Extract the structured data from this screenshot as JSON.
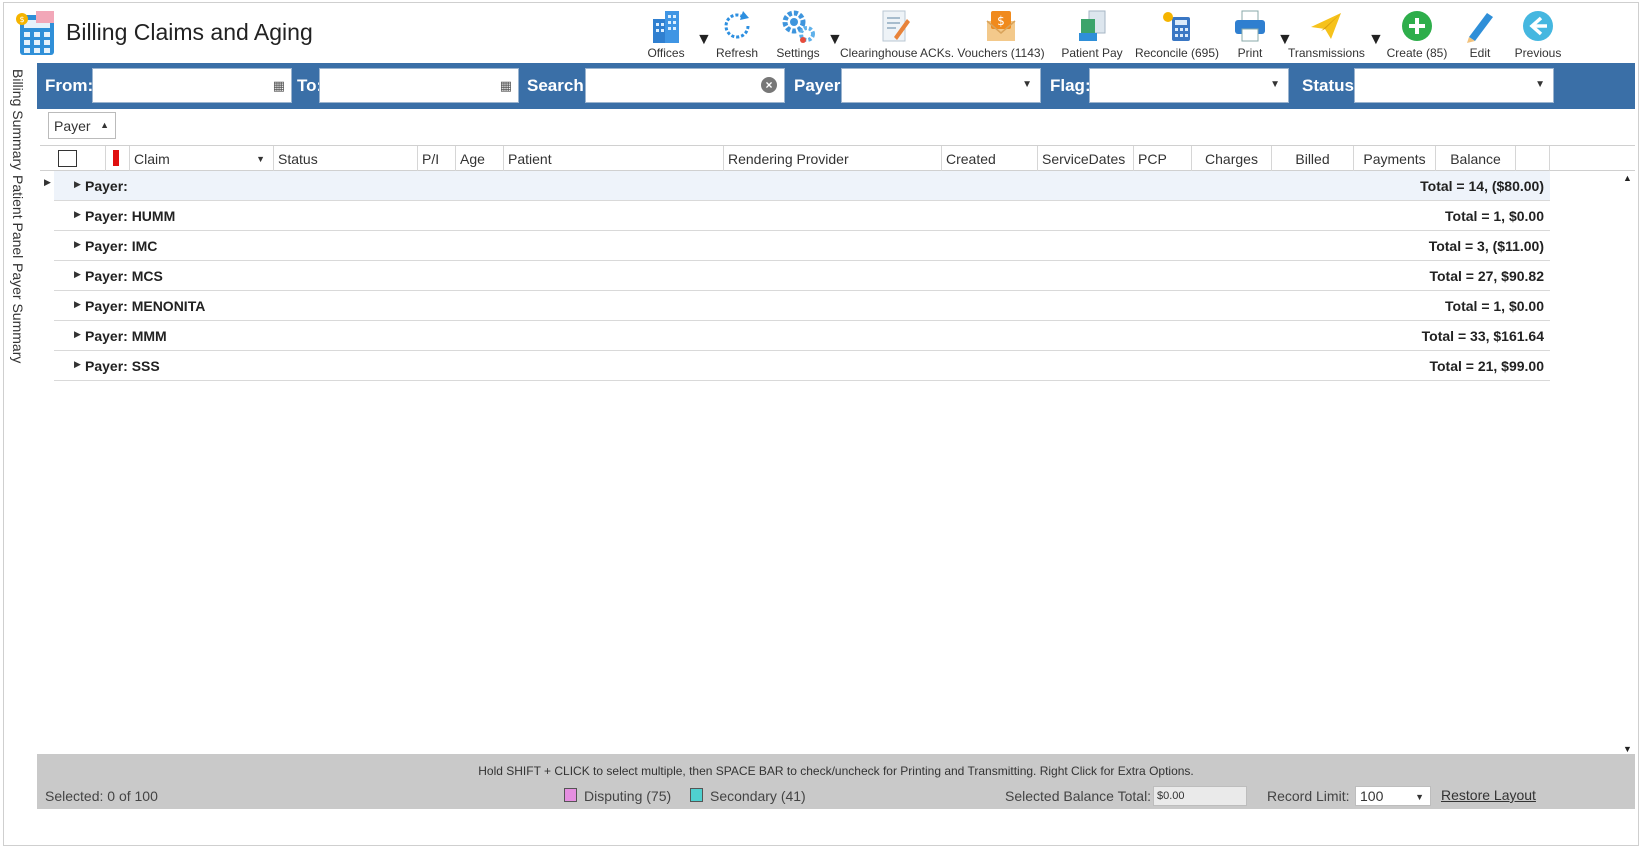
{
  "app": {
    "title": "Billing Claims and Aging",
    "icon": "billing-calculator-icon"
  },
  "toolbar": [
    {
      "label": "Offices",
      "icon": "offices-building-icon",
      "dropdown": true
    },
    {
      "label": "Refresh",
      "icon": "refresh-icon",
      "dropdown": false
    },
    {
      "label": "Settings",
      "icon": "settings-gears-icon",
      "dropdown": true
    },
    {
      "label": "Clearinghouse ACKs.",
      "icon": "clearinghouse-document-icon",
      "dropdown": false
    },
    {
      "label": "Vouchers (1143)",
      "icon": "vouchers-envelope-icon",
      "dropdown": false
    },
    {
      "label": "Patient Pay",
      "icon": "patient-pay-icon",
      "dropdown": false
    },
    {
      "label": "Reconcile (695)",
      "icon": "reconcile-calculator-icon",
      "dropdown": false
    },
    {
      "label": "Print",
      "icon": "printer-icon",
      "dropdown": true
    },
    {
      "label": "Transmissions",
      "icon": "paper-plane-icon",
      "dropdown": true
    },
    {
      "label": "Create (85)",
      "icon": "create-plus-icon",
      "dropdown": false
    },
    {
      "label": "Edit",
      "icon": "edit-pencil-icon",
      "dropdown": false
    },
    {
      "label": "Previous",
      "icon": "previous-arrow-icon",
      "dropdown": false
    }
  ],
  "filters": {
    "from_label": "From:",
    "to_label": "To:",
    "search_label": "Search:",
    "payer_label": "Payer:",
    "flag_label": "Flag:",
    "status_label": "Status:",
    "from_value": "",
    "to_value": "",
    "search_value": "",
    "payer_value": "",
    "flag_value": "",
    "status_value": ""
  },
  "side_tabs": [
    "Billing Summary",
    "Patient Panel",
    "Payer Summary"
  ],
  "group_by": {
    "label": "Payer"
  },
  "columns": [
    "Claim",
    "Status",
    "P/I",
    "Age",
    "Patient",
    "Rendering Provider",
    "Created",
    "ServiceDates",
    "PCP",
    "Charges",
    "Billed",
    "Payments",
    "Balance"
  ],
  "groups": [
    {
      "name": "Payer:",
      "total": "Total = 14,  ($80.00)"
    },
    {
      "name": "Payer: HUMM",
      "total": "Total = 1,  $0.00"
    },
    {
      "name": "Payer: IMC",
      "total": "Total = 3,  ($11.00)"
    },
    {
      "name": "Payer: MCS",
      "total": "Total = 27,  $90.82"
    },
    {
      "name": "Payer: MENONITA",
      "total": "Total = 1,  $0.00"
    },
    {
      "name": "Payer: MMM",
      "total": "Total = 33,  $161.64"
    },
    {
      "name": "Payer: SSS",
      "total": "Total = 21,  $99.00"
    }
  ],
  "footer": {
    "hint": "Hold SHIFT + CLICK to select multiple, then SPACE BAR to check/uncheck for Printing and Transmitting. Right Click for Extra Options.",
    "selected": "Selected: 0 of 100",
    "disputing": "Disputing (75)",
    "secondary": "Secondary (41)",
    "selected_balance_label": "Selected Balance Total:",
    "selected_balance_value": "$0.00",
    "record_limit_label": "Record Limit:",
    "record_limit_value": "100",
    "restore_layout": "Restore Layout",
    "disputing_color": "#e58fe0",
    "secondary_color": "#4fd0cf"
  }
}
